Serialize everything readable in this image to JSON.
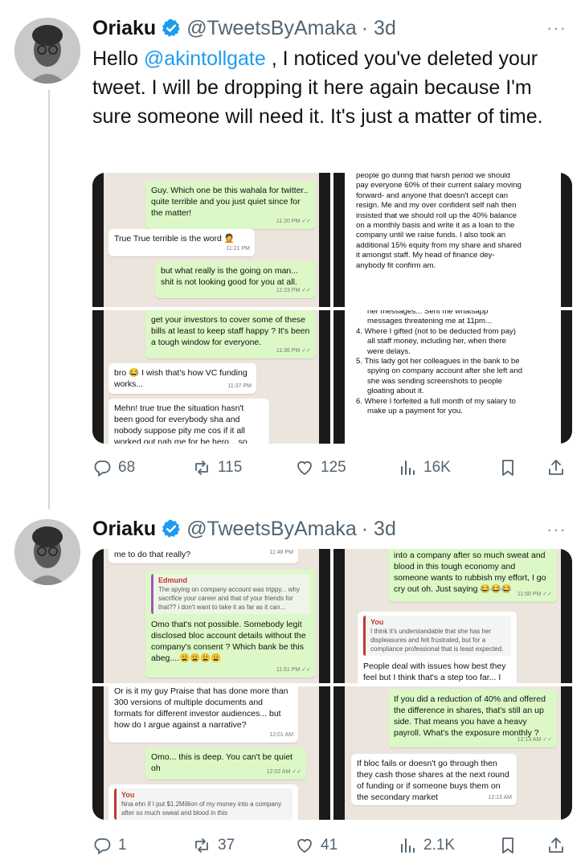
{
  "tweets": [
    {
      "author": "Oriaku",
      "handle": "@TweetsByAmaka",
      "time": "· 3d",
      "more": "···",
      "text_pre": "Hello ",
      "mention": "@akintollgate",
      "text_post": " , I noticed you've deleted your tweet. I will be dropping it here again because I'm sure someone will need it. It's just a matter of time.",
      "stats": {
        "replies": "68",
        "reposts": "115",
        "likes": "125",
        "views": "16K"
      },
      "media": {
        "tl": [
          {
            "side": "out",
            "text": "Guy. Which one be this wahala for twitter.. quite terrible and you just quiet since for the matter!",
            "time": "11:20 PM ✓✓"
          },
          {
            "side": "in",
            "text": "True True terrible is the word 🤦",
            "time": "11:21 PM"
          },
          {
            "side": "out",
            "text": "but what really is the going on man... shit is not looking good for you at all.",
            "time": "11:23 PM ✓✓"
          }
        ],
        "tr": "people go during that harsh period we should pay everyone 60% of their current salary moving forward- and anyone that doesn't accept can resign. Me and my over confident self nah then insisted that we should roll up the 40% balance on a monthly basis and write it as a loan to the company until we raise funds. I also took an additional 15% equity from my share and shared it amongst staff. My head of finance dey- anybody fit confirm am.",
        "bl": [
          {
            "side": "out",
            "text": "get your investors to cover some of these bills at least to keep staff happy ? It's been a tough window for everyone.",
            "time": "11:36 PM ✓✓"
          },
          {
            "side": "in",
            "text": "bro 😂 I wish that's how VC funding works...",
            "time": "11:37 PM"
          },
          {
            "side": "in",
            "text": "Mehn! true true the situation hasn't been good for everybody sha and nobody suppose pity me cos if it all worked out nah me for be hero... so",
            "time": ""
          }
        ],
        "br_top": "her messages... Sent me whatsapp messages threatening me at 11pm...",
        "br_items": [
          "4. Where I gifted (not to be deducted from pay) all staff money, including her, when there were delays.",
          "5. This lady got her colleagues in the bank to be spying on company account after she left and she was sending screenshots to people gloating about it.",
          "6. Where I forfeited a full month of my salary to make up a payment for you."
        ]
      }
    },
    {
      "author": "Oriaku",
      "handle": "@TweetsByAmaka",
      "time": "· 3d",
      "more": "···",
      "stats": {
        "replies": "1",
        "reposts": "37",
        "likes": "41",
        "views": "2.1K"
      },
      "media": {
        "tl_top": {
          "text": "me to do that really?",
          "time": "11:48 PM"
        },
        "tl_quote_name": "Edmund",
        "tl_quote": "The spying on company account was trippy... why sacrifice your career and that of your friends for that?? i don't want to take it as far as it can...",
        "tl_reply": {
          "text": "Omo that's not possible. Somebody legit disclosed bloc account details without the company's consent ? Which bank be this abeg....😩😩😩😩",
          "time": "11:51 PM ✓✓"
        },
        "tr_top": {
          "text": "into a company after so much sweat and blood in this tough economy and someone wants to rubbish my effort, I go cry out oh. Just saying 😂😂😂",
          "time": "11:58 PM ✓✓"
        },
        "tr_you": "You",
        "tr_you_text": "I think it's understandable that she has her displeasures and felt frustrated, but for a compliance professional that is least expected.",
        "tr_reply": "People deal with issues how best they feel but I think that's a step too far... I",
        "bl_top": {
          "text": "Or is it my guy Praise that has done more than 300 versions of multiple documents and formats for different investor audiences... but how do I argue against a narrative?",
          "time": "12:01 AM"
        },
        "bl_out": {
          "text": "Omo... this is deep. You can't be quiet oh",
          "time": "12:02 AM ✓✓"
        },
        "bl_you": "You",
        "bl_you_text": "Nna ehn if I put $1.2Million of my money into a company after so much sweat and blood in this",
        "br_out": {
          "text": "If you did a reduction of 40% and offered the difference in shares, that's still an up side. That means you have a heavy payroll. What's the exposure monthly ?",
          "time": "12:13 AM ✓✓"
        },
        "br_in": {
          "text": "If bloc fails or doesn't go through then they cash those shares at the next round of funding or if someone buys them on the secondary market",
          "time": "12:13 AM"
        }
      }
    }
  ],
  "colors": {
    "accent": "#1d9bf0",
    "verified": "#1d9bf0",
    "bubble_out": "#dcf8c6",
    "chat_bg": "#ece5dd"
  },
  "icons": [
    "reply-icon",
    "repost-icon",
    "like-icon",
    "views-icon",
    "bookmark-icon",
    "share-icon",
    "verified-badge-icon",
    "more-icon"
  ]
}
